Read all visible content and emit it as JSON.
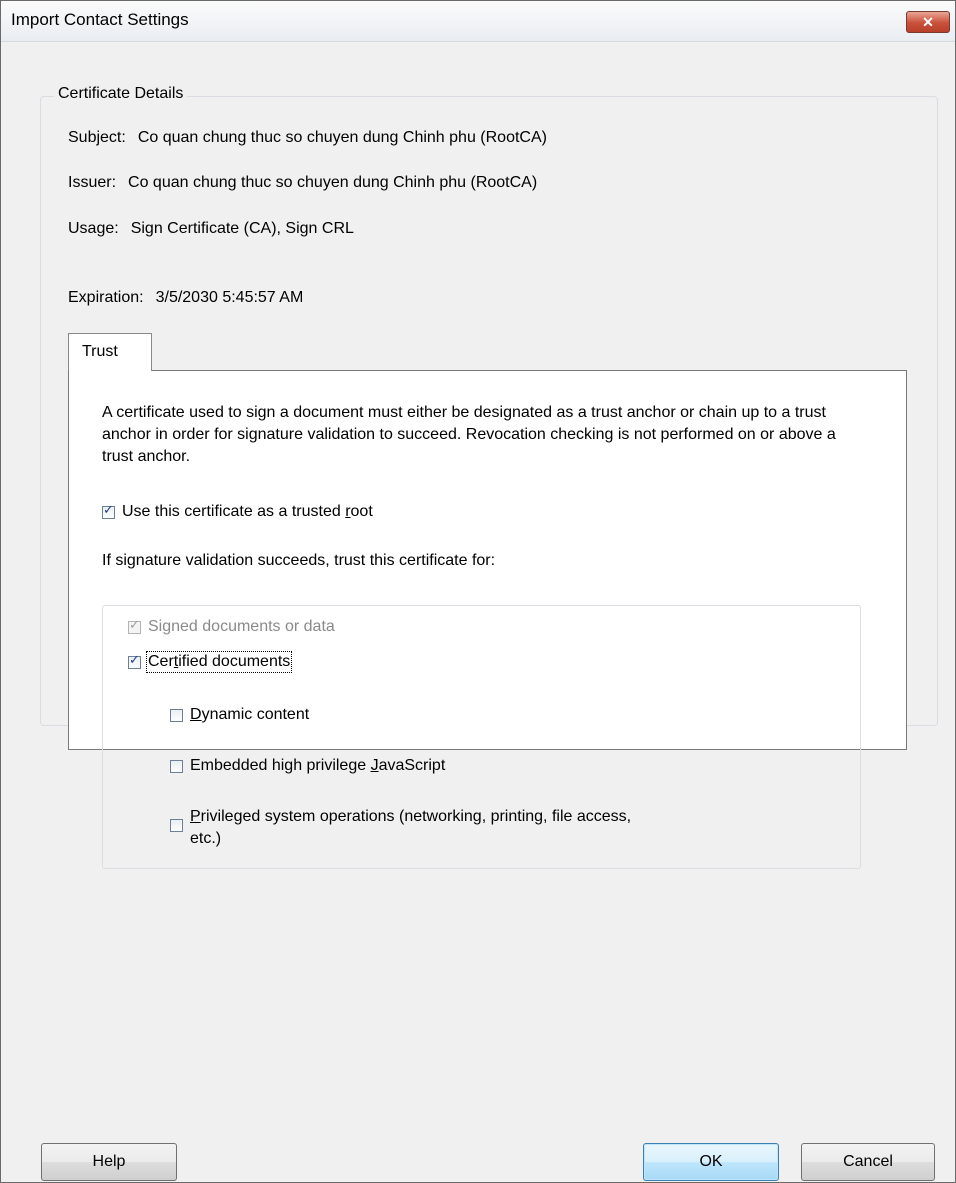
{
  "window": {
    "title": "Import Contact Settings",
    "close_label": "✕"
  },
  "certificate": {
    "group_label": "Certificate Details",
    "subject_label": "Subject:",
    "subject_value": "Co quan chung thuc so chuyen dung Chinh phu (RootCA)",
    "issuer_label": "Issuer:",
    "issuer_value": "Co quan chung thuc so chuyen dung Chinh phu (RootCA)",
    "usage_label": "Usage:",
    "usage_value": "Sign Certificate (CA), Sign CRL",
    "expiration_label": "Expiration:",
    "expiration_value": "3/5/2030 5:45:57 AM"
  },
  "tabs": [
    {
      "label": "Trust",
      "selected": true
    }
  ],
  "trust": {
    "description": "A certificate used to sign a document must either be designated as a trust anchor or chain up to a trust anchor in order for signature validation to succeed.  Revocation checking is not performed on or above a trust anchor.",
    "trusted_root": {
      "label_pre": "Use this certificate as a trusted ",
      "label_key": "r",
      "label_post": "oot",
      "checked": true
    },
    "trust_for_label": "If signature validation succeeds, trust this certificate for:",
    "signed_docs": {
      "label": "Signed documents or data",
      "checked": true,
      "disabled": true
    },
    "certified_docs": {
      "label_pre": "Cer",
      "label_key": "t",
      "label_post": "ified documents",
      "checked": true
    },
    "dynamic_content": {
      "label_pre": "",
      "label_key": "D",
      "label_post": "ynamic content",
      "checked": false
    },
    "javascript": {
      "label_pre": "Embedded high privilege ",
      "label_key": "J",
      "label_post": "avaScript",
      "checked": false
    },
    "privileged_ops": {
      "label_pre": "",
      "label_key": "P",
      "label_post": "rivileged system operations (networking, printing, file access,",
      "label_line2": "etc.)",
      "checked": false
    }
  },
  "buttons": {
    "help": "Help",
    "ok": "OK",
    "cancel": "Cancel"
  }
}
